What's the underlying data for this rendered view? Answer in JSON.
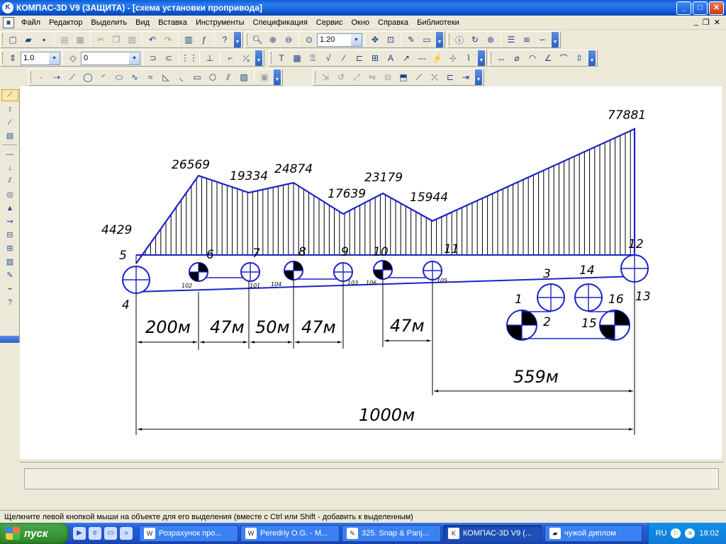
{
  "window": {
    "title": "КОМПАС-3D V9 (ЗАЩИТА) - [схема установки проприводa]",
    "minimize": "_",
    "maximize": "□",
    "close": "✕",
    "mdi_min": "_",
    "mdi_restore": "❐",
    "mdi_close": "✕"
  },
  "menu": [
    "Файл",
    "Редактор",
    "Выделить",
    "Вид",
    "Вставка",
    "Инструменты",
    "Спецификация",
    "Сервис",
    "Окно",
    "Справка",
    "Библиотеки"
  ],
  "toolbar": {
    "zoom_value": "1.20",
    "line_width_value": "1.0",
    "layer_value": "0"
  },
  "drawing": {
    "values": [
      {
        "label": "4429"
      },
      {
        "label": "26569"
      },
      {
        "label": "19334"
      },
      {
        "label": "24874"
      },
      {
        "label": "17639"
      },
      {
        "label": "23179"
      },
      {
        "label": "15944"
      },
      {
        "label": "77881"
      }
    ],
    "node_numbers": [
      "5",
      "6",
      "7",
      "8",
      "9",
      "10",
      "11",
      "12",
      "4",
      "3",
      "14",
      "1",
      "16",
      "13",
      "2",
      "15"
    ],
    "small_labels": [
      "102",
      "101",
      "104",
      "103",
      "106",
      "105"
    ],
    "dimensions": [
      "200м",
      "47м",
      "50м",
      "47м",
      "47м",
      "559м",
      "1000м"
    ]
  },
  "status": {
    "hint": "Щелкните левой кнопкой мыши на объекте для его выделения (вместе с Ctrl или Shift - добавить к выделенным)"
  },
  "taskbar": {
    "start_label": "пуск",
    "tasks": [
      {
        "label": "Розрахунок про..."
      },
      {
        "label": "Peredriy O.G. - M..."
      },
      {
        "label": "325. Snap & Panj..."
      },
      {
        "label": "КОМПАС-3D V9 (..."
      },
      {
        "label": "чужой диплом"
      }
    ],
    "lang": "RU",
    "time": "18:02"
  }
}
